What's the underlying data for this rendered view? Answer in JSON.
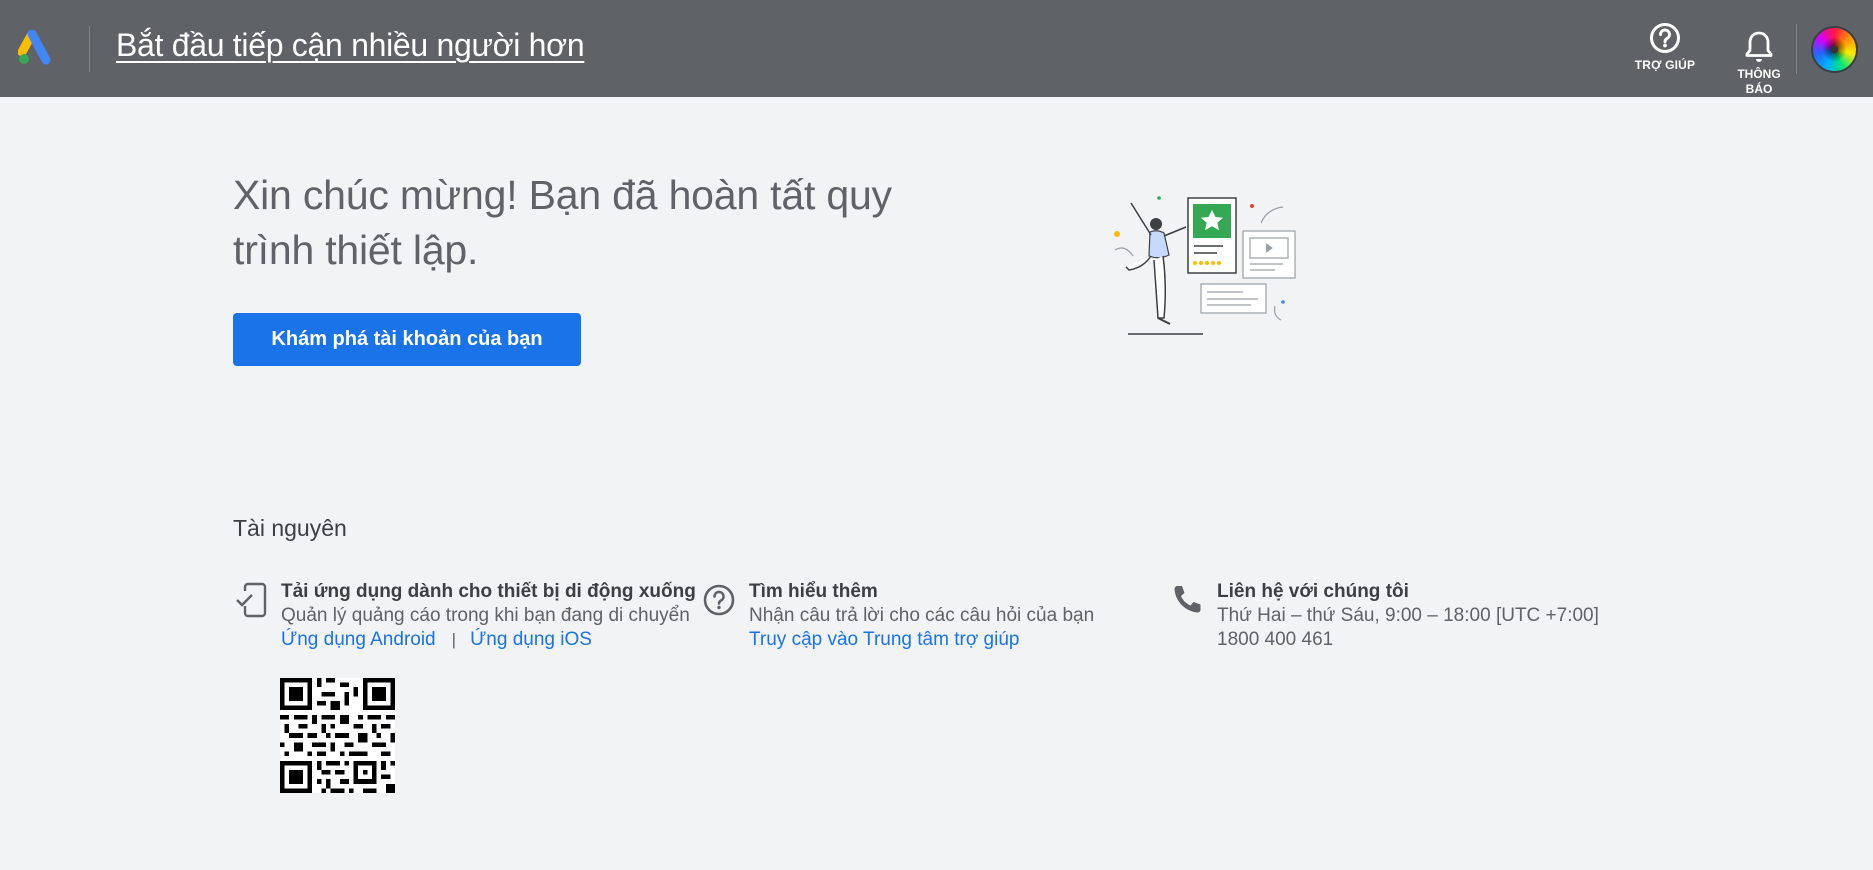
{
  "header": {
    "logo_icon": "google-ads-logo-icon",
    "title": "Bắt đầu tiếp cận nhiều người hơn",
    "help_label": "TRỢ GIÚP",
    "help_icon": "help-circle-icon",
    "notifications_label": "THÔNG BÁO",
    "notifications_icon": "bell-icon",
    "avatar_icon": "account-avatar-icon"
  },
  "main": {
    "congrats_heading": "Xin chúc mừng! Bạn đã hoàn tất quy trình thiết lập.",
    "explore_button": "Khám phá tài khoản của bạn",
    "illustration": "celebration-illustration"
  },
  "resources": {
    "title": "Tài nguyên",
    "mobile": {
      "icon": "mobile-phone-check-icon",
      "heading": "Tải ứng dụng dành cho thiết bị di động xuống",
      "description": "Quản lý quảng cáo trong khi bạn đang di chuyển",
      "android_link": "Ứng dụng Android",
      "separator": "|",
      "ios_link": "Ứng dụng iOS",
      "qr_icon": "qr-code-icon"
    },
    "learn": {
      "icon": "help-outline-icon",
      "heading": "Tìm hiểu thêm",
      "description": "Nhận câu trả lời cho các câu hỏi của bạn",
      "link": "Truy cập vào Trung tâm trợ giúp"
    },
    "contact": {
      "icon": "phone-icon",
      "heading": "Liên hệ với chúng tôi",
      "hours": "Thứ Hai – thứ Sáu, 9:00 – 18:00 [UTC +7:00]",
      "phone": "1800 400 461"
    }
  },
  "colors": {
    "header_bg": "#5f6368",
    "page_bg": "#f1f3f4",
    "primary": "#1a73e8",
    "text": "#3c4043"
  }
}
